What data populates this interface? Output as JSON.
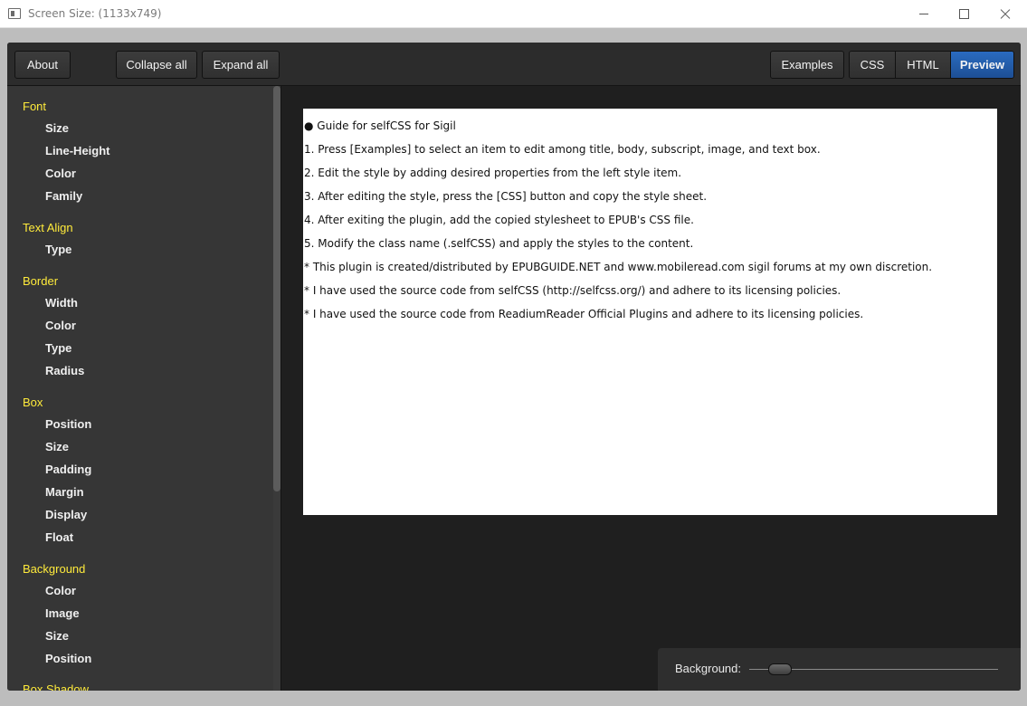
{
  "window": {
    "title": "Screen Size: (1133x749)"
  },
  "toolbar": {
    "about": "About",
    "collapse_all": "Collapse all",
    "expand_all": "Expand all",
    "examples": "Examples",
    "css": "CSS",
    "html": "HTML",
    "preview": "Preview"
  },
  "sidebar": {
    "groups": [
      {
        "label": "Font",
        "items": [
          "Size",
          "Line-Height",
          "Color",
          "Family"
        ]
      },
      {
        "label": "Text Align",
        "items": [
          "Type"
        ]
      },
      {
        "label": "Border",
        "items": [
          "Width",
          "Color",
          "Type",
          "Radius"
        ]
      },
      {
        "label": "Box",
        "items": [
          "Position",
          "Size",
          "Padding",
          "Margin",
          "Display",
          "Float"
        ]
      },
      {
        "label": "Background",
        "items": [
          "Color",
          "Image",
          "Size",
          "Position"
        ]
      },
      {
        "label": "Box Shadow",
        "items": []
      }
    ]
  },
  "preview": {
    "lines": [
      "● Guide for selfCSS for Sigil",
      "1. Press [Examples] to select an item to edit among title, body, subscript, image, and text box.",
      "2. Edit the style by adding desired properties from the left style item.",
      "3. After editing the style, press the [CSS] button and copy the style sheet.",
      "4. After exiting the plugin, add the copied stylesheet to EPUB's CSS file.",
      "5. Modify the class name (.selfCSS) and apply the styles to the content.",
      "* This plugin is created/distributed by EPUBGUIDE.NET and www.mobileread.com sigil forums at my own discretion.",
      "* I have used the source code from selfCSS (http://selfcss.org/) and adhere to its licensing policies.",
      "* I have used the source code from ReadiumReader Official Plugins and adhere to its licensing policies."
    ],
    "background_label": "Background:",
    "background_level": 0.12
  }
}
